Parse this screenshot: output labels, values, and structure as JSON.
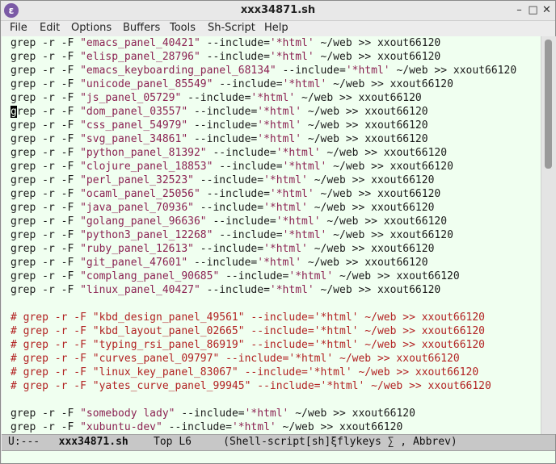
{
  "window": {
    "title": "xxx34871.sh",
    "app_icon": "emacs-icon"
  },
  "window_controls": {
    "minimize": "–",
    "maximize": "□",
    "close": "✕"
  },
  "menu": [
    "File",
    "Edit",
    "Options",
    "Buffers",
    "Tools",
    "Sh-Script",
    "Help"
  ],
  "lines": [
    {
      "pre": "grep -r -F ",
      "s1": "\"emacs_panel_40421\"",
      "mid": " --include=",
      "s2": "'*html'",
      "post": " ~/web >> xxout66120",
      "type": "code"
    },
    {
      "pre": "grep -r -F ",
      "s1": "\"elisp_panel_28796\"",
      "mid": " --include=",
      "s2": "'*html'",
      "post": " ~/web >> xxout66120",
      "type": "code"
    },
    {
      "pre": "grep -r -F ",
      "s1": "\"emacs_keyboarding_panel_68134\"",
      "mid": " --include=",
      "s2": "'*html'",
      "post": " ~/web >> xxout66120",
      "type": "code"
    },
    {
      "pre": "grep -r -F ",
      "s1": "\"unicode_panel_85549\"",
      "mid": " --include=",
      "s2": "'*html'",
      "post": " ~/web >> xxout66120",
      "type": "code"
    },
    {
      "pre": "grep -r -F ",
      "s1": "\"js_panel_05729\"",
      "mid": " --include=",
      "s2": "'*html'",
      "post": " ~/web >> xxout66120",
      "type": "code"
    },
    {
      "pre": "grep -r -F ",
      "s1": "\"dom_panel_03557\"",
      "mid": " --include=",
      "s2": "'*html'",
      "post": " ~/web >> xxout66120",
      "type": "code"
    },
    {
      "pre": "grep -r -F ",
      "s1": "\"css_panel_54979\"",
      "mid": " --include=",
      "s2": "'*html'",
      "post": " ~/web >> xxout66120",
      "type": "code"
    },
    {
      "pre": "grep -r -F ",
      "s1": "\"svg_panel_34861\"",
      "mid": " --include=",
      "s2": "'*html'",
      "post": " ~/web >> xxout66120",
      "type": "code"
    },
    {
      "pre": "grep -r -F ",
      "s1": "\"python_panel_81392\"",
      "mid": " --include=",
      "s2": "'*html'",
      "post": " ~/web >> xxout66120",
      "type": "code"
    },
    {
      "pre": "grep -r -F ",
      "s1": "\"clojure_panel_18853\"",
      "mid": " --include=",
      "s2": "'*html'",
      "post": " ~/web >> xxout66120",
      "type": "code"
    },
    {
      "pre": "grep -r -F ",
      "s1": "\"perl_panel_32523\"",
      "mid": " --include=",
      "s2": "'*html'",
      "post": " ~/web >> xxout66120",
      "type": "code"
    },
    {
      "pre": "grep -r -F ",
      "s1": "\"ocaml_panel_25056\"",
      "mid": " --include=",
      "s2": "'*html'",
      "post": " ~/web >> xxout66120",
      "type": "code"
    },
    {
      "pre": "grep -r -F ",
      "s1": "\"java_panel_70936\"",
      "mid": " --include=",
      "s2": "'*html'",
      "post": " ~/web >> xxout66120",
      "type": "code"
    },
    {
      "pre": "grep -r -F ",
      "s1": "\"golang_panel_96636\"",
      "mid": " --include=",
      "s2": "'*html'",
      "post": " ~/web >> xxout66120",
      "type": "code"
    },
    {
      "pre": "grep -r -F ",
      "s1": "\"python3_panel_12268\"",
      "mid": " --include=",
      "s2": "'*html'",
      "post": " ~/web >> xxout66120",
      "type": "code"
    },
    {
      "pre": "grep -r -F ",
      "s1": "\"ruby_panel_12613\"",
      "mid": " --include=",
      "s2": "'*html'",
      "post": " ~/web >> xxout66120",
      "type": "code"
    },
    {
      "pre": "grep -r -F ",
      "s1": "\"git_panel_47601\"",
      "mid": " --include=",
      "s2": "'*html'",
      "post": " ~/web >> xxout66120",
      "type": "code"
    },
    {
      "pre": "grep -r -F ",
      "s1": "\"complang_panel_90685\"",
      "mid": " --include=",
      "s2": "'*html'",
      "post": " ~/web >> xxout66120",
      "type": "code"
    },
    {
      "pre": "grep -r -F ",
      "s1": "\"linux_panel_40427\"",
      "mid": " --include=",
      "s2": "'*html'",
      "post": " ~/web >> xxout66120",
      "type": "code"
    },
    {
      "type": "blank"
    },
    {
      "text": "# grep -r -F \"kbd_design_panel_49561\" --include='*html' ~/web >> xxout66120",
      "type": "comment"
    },
    {
      "text": "# grep -r -F \"kbd_layout_panel_02665\" --include='*html' ~/web >> xxout66120",
      "type": "comment"
    },
    {
      "text": "# grep -r -F \"typing_rsi_panel_86919\" --include='*html' ~/web >> xxout66120",
      "type": "comment"
    },
    {
      "text": "# grep -r -F \"curves_panel_09797\" --include='*html' ~/web >> xxout66120",
      "type": "comment"
    },
    {
      "text": "# grep -r -F \"linux_key_panel_83067\" --include='*html' ~/web >> xxout66120",
      "type": "comment"
    },
    {
      "text": "# grep -r -F \"yates_curve_panel_99945\" --include='*html' ~/web >> xxout66120",
      "type": "comment"
    },
    {
      "type": "blank"
    },
    {
      "pre": "grep -r -F ",
      "s1": "\"somebody lady\"",
      "mid": " --include=",
      "s2": "'*html'",
      "post": " ~/web >> xxout66120",
      "type": "code"
    },
    {
      "pre": "grep -r -F ",
      "s1": "\"xubuntu-dev\"",
      "mid": " --include=",
      "s2": "'*html'",
      "post": " ~/web >> xxout66120",
      "type": "code"
    }
  ],
  "cursor": {
    "line": 6,
    "column": 1
  },
  "modeline": {
    "status": "U:---",
    "buffer": "xxx34871.sh",
    "position": "Top L6",
    "modes": "(Shell-script[sh]ξflykeys ∑ , Abbrev)"
  },
  "scrollbar": {
    "visible_fraction": 0.33,
    "offset_fraction": 0.0
  },
  "colors": {
    "background": "#f0fff0",
    "string": "#8b2252",
    "comment": "#b22222"
  }
}
